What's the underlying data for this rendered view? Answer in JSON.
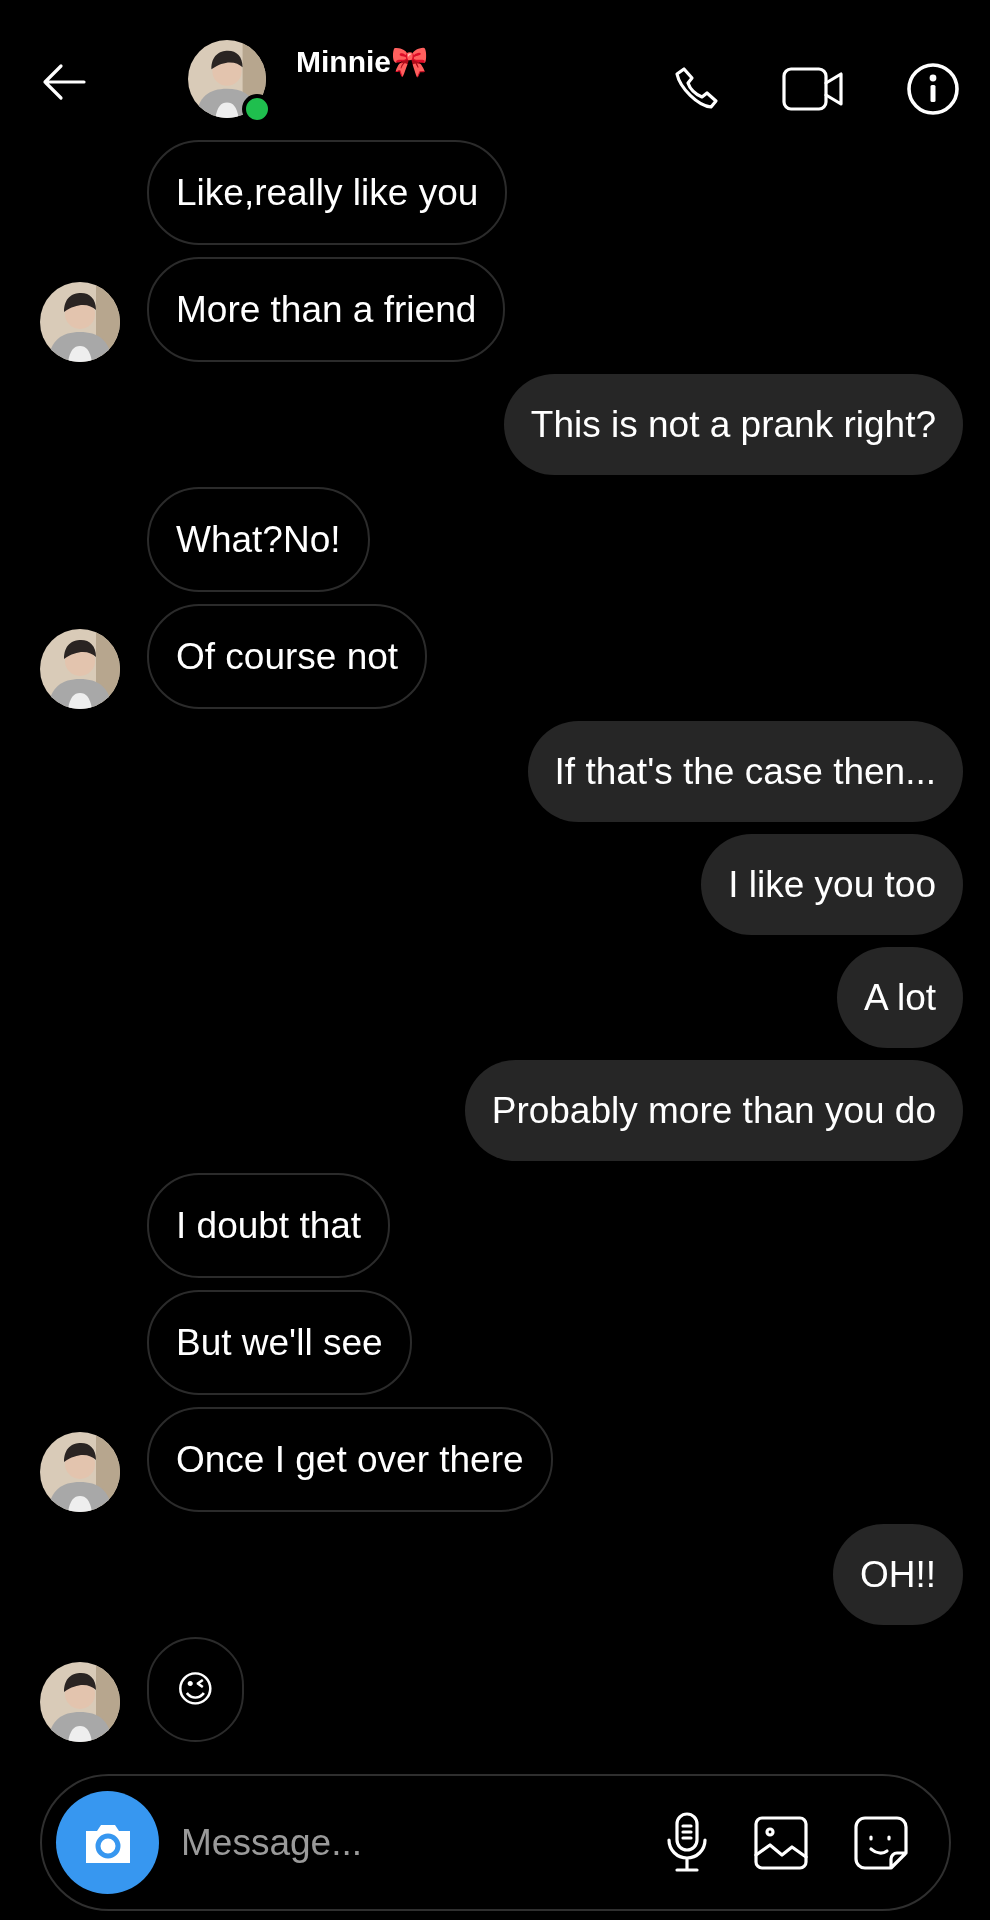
{
  "header": {
    "name": "Minnie🎀",
    "online": true
  },
  "messages": [
    {
      "text": "Like,really like you",
      "kind": "received",
      "avatar": false
    },
    {
      "text": "More than a friend",
      "kind": "received",
      "avatar": true
    },
    {
      "text": "This is not a prank right?",
      "kind": "sent"
    },
    {
      "text": "What?No!",
      "kind": "received",
      "avatar": false
    },
    {
      "text": "Of course not",
      "kind": "received",
      "avatar": true
    },
    {
      "text": "If that's the case then...",
      "kind": "sent"
    },
    {
      "text": "I like you too",
      "kind": "sent"
    },
    {
      "text": "A lot",
      "kind": "sent"
    },
    {
      "text": "Probably more than you do",
      "kind": "sent"
    },
    {
      "text": "I doubt that",
      "kind": "received",
      "avatar": false
    },
    {
      "text": "But we'll see",
      "kind": "received",
      "avatar": false
    },
    {
      "text": "Once I get over there",
      "kind": "received",
      "avatar": true
    },
    {
      "text": "OH!!",
      "kind": "sent"
    },
    {
      "text": "😉",
      "kind": "received",
      "avatar": true
    }
  ],
  "composer": {
    "placeholder": "Message..."
  }
}
